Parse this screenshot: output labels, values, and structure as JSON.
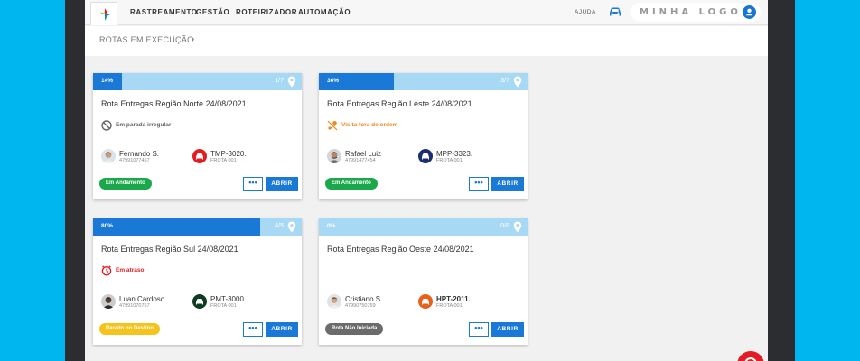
{
  "nav": {
    "items": [
      "RASTREAMENTO",
      "GESTÃO",
      "ROTEIRIZADOR",
      "AUTOMAÇÃO"
    ],
    "help_label": "AJUDA",
    "company_logo_text": "MINHA LOGO"
  },
  "breadcrumb": {
    "label": "ROTAS EM EXECUÇÃO"
  },
  "colors": {
    "brand_blue": "#1a78d6",
    "progress_track": "#a7d9f5",
    "status_green": "#19a84a",
    "status_yellow": "#f5c31b",
    "status_gray": "#6b6b6b",
    "alert_red": "#e31b23",
    "alert_orange": "#f08a1c"
  },
  "cards": [
    {
      "progress_label": "14%",
      "progress": 0.14,
      "steps": "1/7",
      "title": "Rota Entregas Região Norte 24/08/2021",
      "status_text": "Em parada irregular",
      "status_icon": "no-entry-icon",
      "status_color": "#666666",
      "driver_name": "Fernando S.",
      "driver_phone": "47991077457",
      "vehicle_plate": "TMP-3020.",
      "vehicle_fleet": "FROTA 001",
      "vehicle_color": "#e31b23",
      "badge": "Em Andamento",
      "badge_color": "#19a84a",
      "more_label": "•••",
      "open_label": "ABRIR"
    },
    {
      "progress_label": "36%",
      "progress": 0.36,
      "steps": "3/7",
      "title": "Rota Entregas Região Leste 24/08/2021",
      "status_text": "Visita fora de ordem",
      "status_icon": "route-off-icon",
      "status_color": "#f08a1c",
      "driver_name": "Rafael Luiz",
      "driver_phone": "47991477454",
      "vehicle_plate": "MPP-3323.",
      "vehicle_fleet": "FROTA 001",
      "vehicle_color": "#1a2f6b",
      "badge": "Em Andamento",
      "badge_color": "#19a84a",
      "more_label": "•••",
      "open_label": "ABRIR"
    },
    {
      "progress_label": "80%",
      "progress": 0.8,
      "steps": "4/5",
      "title": "Rota Entregas Região Sul 24/08/2021",
      "status_text": "Em atraso",
      "status_icon": "clock-icon",
      "status_color": "#e31b23",
      "driver_name": "Luan Cardoso",
      "driver_phone": "47991070757",
      "vehicle_plate": "PMT-3000.",
      "vehicle_fleet": "FROTA 001",
      "vehicle_color": "#0f3b22",
      "badge": "Parado no Destino",
      "badge_color": "#f5c31b",
      "more_label": "•••",
      "open_label": "ABRIR"
    },
    {
      "progress_label": "0%",
      "progress": 0,
      "steps": "0/8",
      "title": "Rota Entregas Região Oeste 24/08/2021",
      "status_text": "",
      "status_icon": "",
      "status_color": "",
      "driver_name": "Cristiano S.",
      "driver_phone": "47990750759",
      "vehicle_plate": "HPT-2011.",
      "vehicle_fleet": "FROTA 001",
      "vehicle_color": "#e8611a",
      "badge": "Rota Não Iniciada",
      "badge_color": "#6b6b6b",
      "more_label": "•••",
      "open_label": "ABRIR"
    }
  ]
}
